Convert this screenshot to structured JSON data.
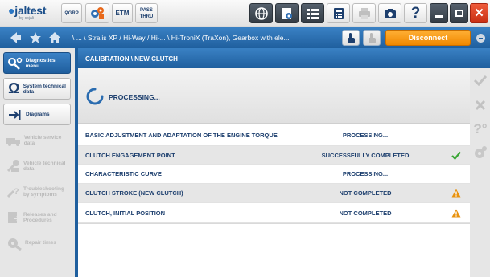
{
  "app": {
    "logo_text": "jaltest",
    "logo_sub": "by cojali"
  },
  "toolbar": {
    "grp_label": "GRP",
    "etm_label": "ETM",
    "pass_thru_line1": "PASS",
    "pass_thru_line2": "THRU"
  },
  "nav": {
    "breadcrumb": "\\ ... \\ Stralis XP / Hi-Way / Hi-... \\ Hi-TroniX (TraXon), Gearbox with ele...",
    "disconnect_label": "Disconnect"
  },
  "sidebar": {
    "items": [
      {
        "label": "Diagnostics menu",
        "state": "active",
        "icon": "diagnostics-icon"
      },
      {
        "label": "System technical data",
        "state": "enabled",
        "icon": "ohm-icon"
      },
      {
        "label": "Diagrams",
        "state": "enabled",
        "icon": "diagram-icon"
      },
      {
        "label": "Vehicle service data",
        "state": "disabled",
        "icon": "truck-icon"
      },
      {
        "label": "Vehicle technical data",
        "state": "disabled",
        "icon": "wrench-icon"
      },
      {
        "label": "Troubleshooting by symptoms",
        "state": "disabled",
        "icon": "troubleshoot-icon"
      },
      {
        "label": "Releases and Procedures",
        "state": "disabled",
        "icon": "procedures-icon"
      },
      {
        "label": "Repair times",
        "state": "disabled",
        "icon": "repair-icon"
      }
    ]
  },
  "main": {
    "title": "CALIBRATION \\ NEW CLUTCH",
    "processing_label": "PROCESSING...",
    "rows": [
      {
        "name": "BASIC ADJUSTMENT AND ADAPTATION OF THE ENGINE TORQUE",
        "status": "PROCESSING...",
        "icon": "none"
      },
      {
        "name": "CLUTCH ENGAGEMENT POINT",
        "status": "SUCCESSFULLY COMPLETED",
        "icon": "check-icon"
      },
      {
        "name": "CHARACTERISTIC CURVE",
        "status": "PROCESSING...",
        "icon": "none"
      },
      {
        "name": "CLUTCH STROKE (NEW CLUTCH)",
        "status": "NOT COMPLETED",
        "icon": "warning-icon"
      },
      {
        "name": "CLUTCH, INITIAL POSITION",
        "status": "NOT COMPLETED",
        "icon": "warning-icon"
      }
    ]
  },
  "colors": {
    "header_blue": "#1f5f9e",
    "text_navy": "#1d3f6e",
    "success_green": "#3aa635",
    "warning_orange": "#e8920e",
    "disconnect_orange": "#f08800",
    "close_red": "#d93a18"
  }
}
